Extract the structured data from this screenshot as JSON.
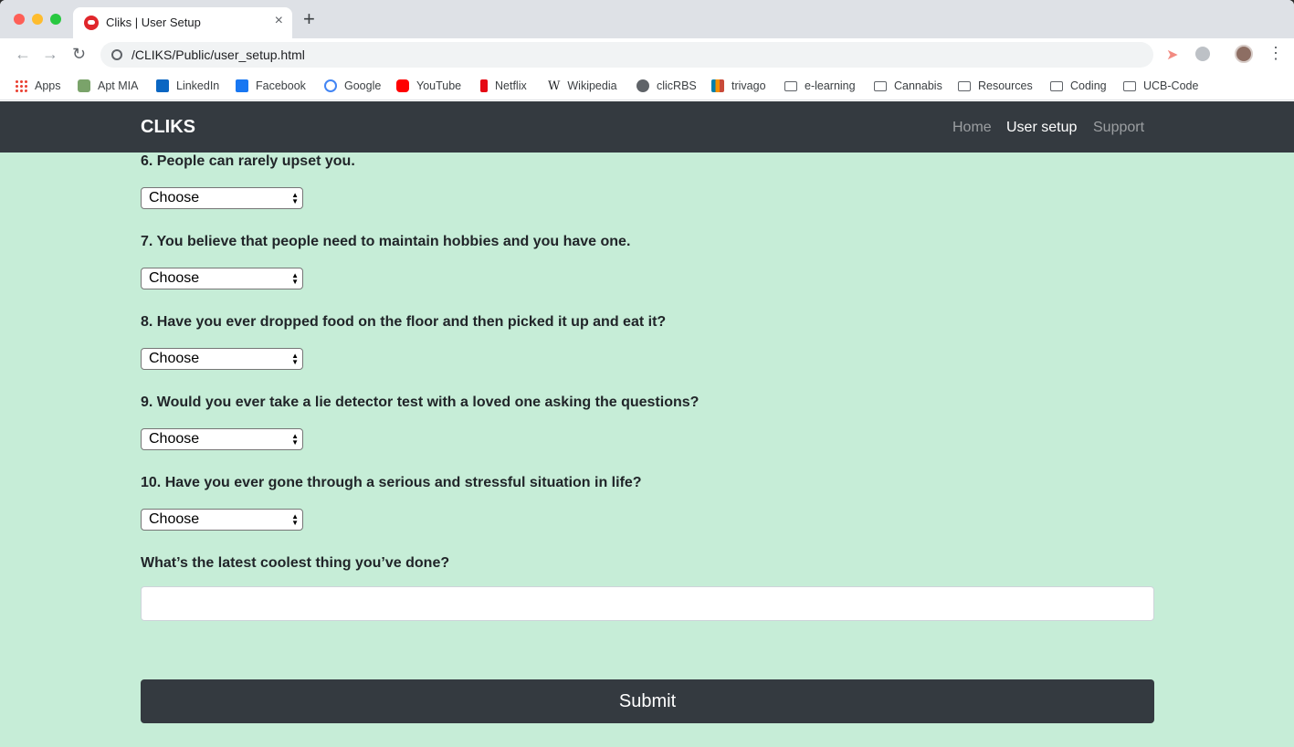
{
  "browser": {
    "tab_title": "Cliks | User Setup",
    "tab_close": "×",
    "new_tab": "+",
    "back": "←",
    "forward": "→",
    "reload": "↻",
    "url": "/CLIKS/Public/user_setup.html",
    "menu": "⋮"
  },
  "bookmarks": [
    {
      "label": "Apps",
      "icon": "apps-icon"
    },
    {
      "label": "Apt MIA",
      "icon": "aptmia-icon"
    },
    {
      "label": "LinkedIn",
      "icon": "linkedin-icon"
    },
    {
      "label": "Facebook",
      "icon": "facebook-icon"
    },
    {
      "label": "Google",
      "icon": "google-icon"
    },
    {
      "label": "YouTube",
      "icon": "youtube-icon"
    },
    {
      "label": "Netflix",
      "icon": "netflix-icon"
    },
    {
      "label": "Wikipedia",
      "icon": "wikipedia-icon",
      "glyph": "W"
    },
    {
      "label": "clicRBS",
      "icon": "clicrbs-icon"
    },
    {
      "label": "trivago",
      "icon": "trivago-icon"
    },
    {
      "label": "e-learning",
      "icon": "folder-icon"
    },
    {
      "label": "Cannabis",
      "icon": "folder-icon"
    },
    {
      "label": "Resources",
      "icon": "folder-icon"
    },
    {
      "label": "Coding",
      "icon": "folder-icon"
    },
    {
      "label": "UCB-Code",
      "icon": "folder-icon"
    }
  ],
  "navbar": {
    "brand": "CLIKS",
    "links": [
      "Home",
      "User setup",
      "Support"
    ],
    "active": "User setup"
  },
  "form": {
    "questions": [
      {
        "text": "6. People can rarely upset you.",
        "selected": "Choose"
      },
      {
        "text": "7. You believe that people need to maintain hobbies and you have one.",
        "selected": "Choose"
      },
      {
        "text": "8. Have you ever dropped food on the floor and then picked it up and eat it?",
        "selected": "Choose"
      },
      {
        "text": "9. Would you ever take a lie detector test with a loved one asking the questions?",
        "selected": "Choose"
      },
      {
        "text": "10. Have you ever gone through a serious and stressful situation in life?",
        "selected": "Choose"
      }
    ],
    "open_question": "What’s the latest coolest thing you’ve done?",
    "open_answer": "",
    "submit_label": "Submit"
  },
  "colors": {
    "page_background": "#c6edd7",
    "navbar": "#343a40",
    "submit_button": "#343a40"
  }
}
